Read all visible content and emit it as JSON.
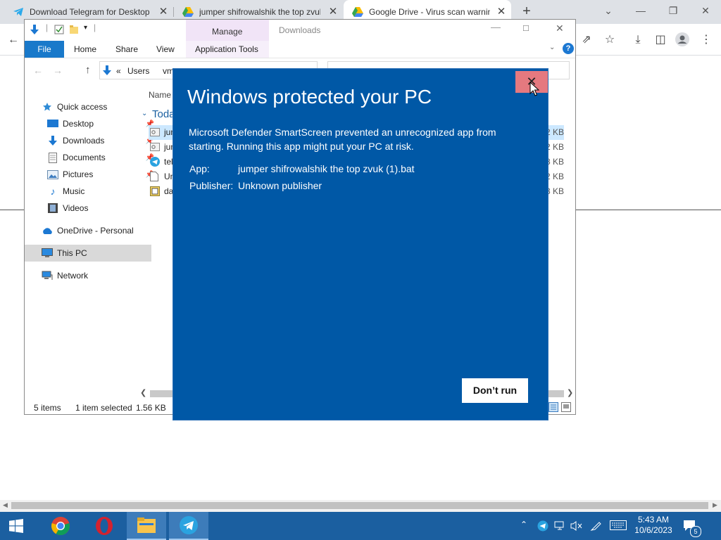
{
  "browser": {
    "tabs": [
      {
        "title": "Download Telegram for Desktop",
        "icon": "telegram-icon"
      },
      {
        "title": "jumper shifrowalshik the top zvuk",
        "icon": "google-drive-icon"
      },
      {
        "title": "Google Drive - Virus scan warning",
        "icon": "google-drive-icon",
        "active": true
      }
    ],
    "new_tab_label": "+",
    "close_label": "✕"
  },
  "explorer": {
    "title": "Downloads",
    "manage_label": "Manage",
    "ribbon_tabs": [
      "File",
      "Home",
      "Share",
      "View",
      "Application Tools"
    ],
    "breadcrumb": [
      "«",
      "Users",
      "vm"
    ],
    "column_header": "Name",
    "group_header": "Toda",
    "nav": [
      {
        "label": "Quick access",
        "icon": "star-icon"
      },
      {
        "label": "Desktop",
        "icon": "desktop-icon",
        "pinned": true
      },
      {
        "label": "Downloads",
        "icon": "downloads-icon",
        "pinned": true
      },
      {
        "label": "Documents",
        "icon": "documents-icon",
        "pinned": true
      },
      {
        "label": "Pictures",
        "icon": "pictures-icon",
        "pinned": true
      },
      {
        "label": "Music",
        "icon": "music-icon"
      },
      {
        "label": "Videos",
        "icon": "videos-icon"
      },
      {
        "label": "OneDrive - Personal",
        "icon": "cloud-icon"
      },
      {
        "label": "This PC",
        "icon": "computer-icon",
        "selected": true
      },
      {
        "label": "Network",
        "icon": "network-icon"
      }
    ],
    "files": [
      {
        "name": "jum",
        "size": "2 KB",
        "selected": true
      },
      {
        "name": "jum",
        "size": "2 KB"
      },
      {
        "name": "tel",
        "size": "8 KB"
      },
      {
        "name": "Un",
        "size": "2 KB"
      },
      {
        "name": "da",
        "size": "3 KB"
      }
    ],
    "status": {
      "items": "5 items",
      "selected": "1 item selected",
      "size": "1.56 KB"
    }
  },
  "dialog": {
    "title": "Windows protected your PC",
    "message": "Microsoft Defender SmartScreen prevented an unrecognized app from starting. Running this app might put your PC at risk.",
    "app_label": "App:",
    "app_value": "jumper shifrowalshik the top zvuk (1).bat",
    "publisher_label": "Publisher:",
    "publisher_value": "Unknown publisher",
    "button": "Don’t run",
    "close_glyph": "✕"
  },
  "taskbar": {
    "time": "5:43 AM",
    "date": "10/6/2023",
    "notification_count": "5"
  },
  "colors": {
    "dialog_bg": "#0058a6",
    "dialog_close_hover": "#e5797f",
    "taskbar": "#1b5fa0",
    "file_tab": "#1979ca"
  }
}
